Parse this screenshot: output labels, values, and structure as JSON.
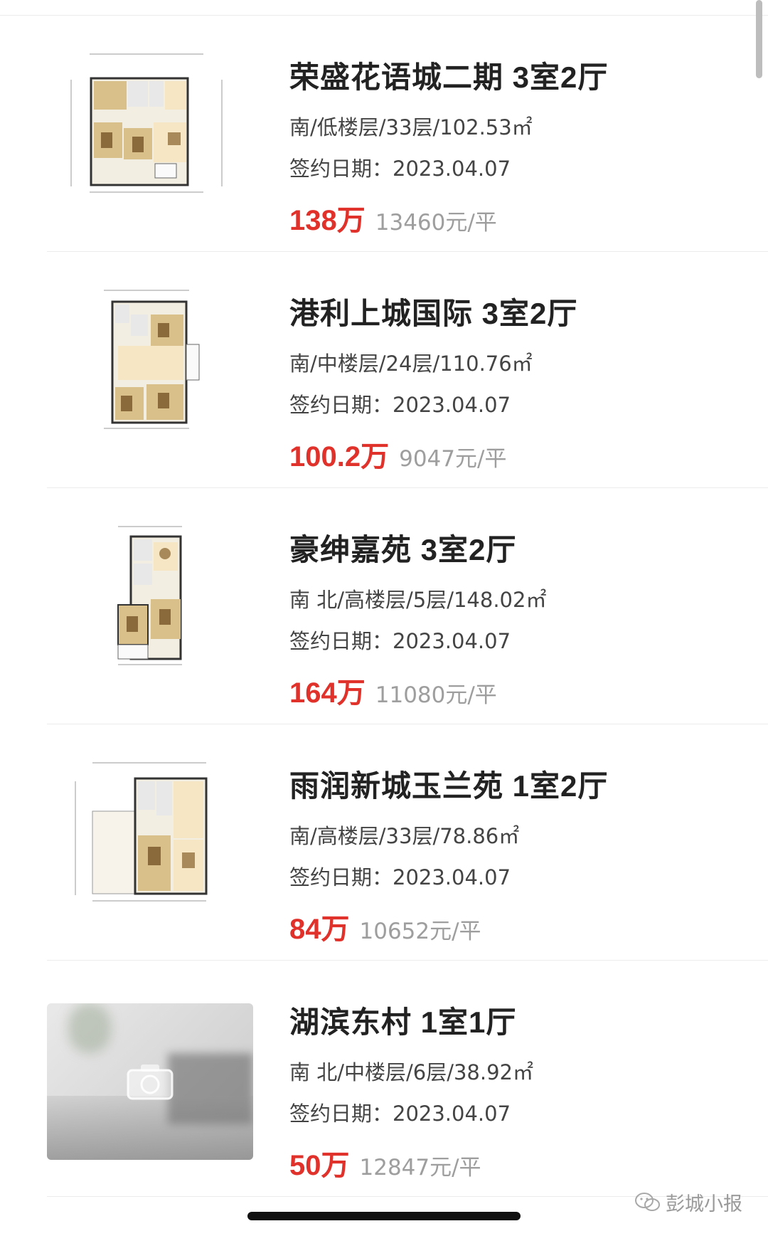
{
  "listings": [
    {
      "title": "荣盛花语城二期 3室2厅",
      "info": "南/低楼层/33层/102.53㎡",
      "date": "签约日期：2023.04.07",
      "price": "138万",
      "unit_price": "13460元/平",
      "thumb": "floorplan"
    },
    {
      "title": "港利上城国际 3室2厅",
      "info": "南/中楼层/24层/110.76㎡",
      "date": "签约日期：2023.04.07",
      "price": "100.2万",
      "unit_price": "9047元/平",
      "thumb": "floorplan"
    },
    {
      "title": "豪绅嘉苑 3室2厅",
      "info": "南 北/高楼层/5层/148.02㎡",
      "date": "签约日期：2023.04.07",
      "price": "164万",
      "unit_price": "11080元/平",
      "thumb": "floorplan"
    },
    {
      "title": "雨润新城玉兰苑 1室2厅",
      "info": "南/高楼层/33层/78.86㎡",
      "date": "签约日期：2023.04.07",
      "price": "84万",
      "unit_price": "10652元/平",
      "thumb": "floorplan"
    },
    {
      "title": "湖滨东村 1室1厅",
      "info": "南 北/中楼层/6层/38.92㎡",
      "date": "签约日期：2023.04.07",
      "price": "50万",
      "unit_price": "12847元/平",
      "thumb": "photo-placeholder"
    }
  ],
  "watermark": {
    "text": "彭城小报",
    "icon": "wechat-icon"
  },
  "colors": {
    "price": "#e0312b",
    "unit_price": "#9e9e9e",
    "divider": "#ececec"
  }
}
